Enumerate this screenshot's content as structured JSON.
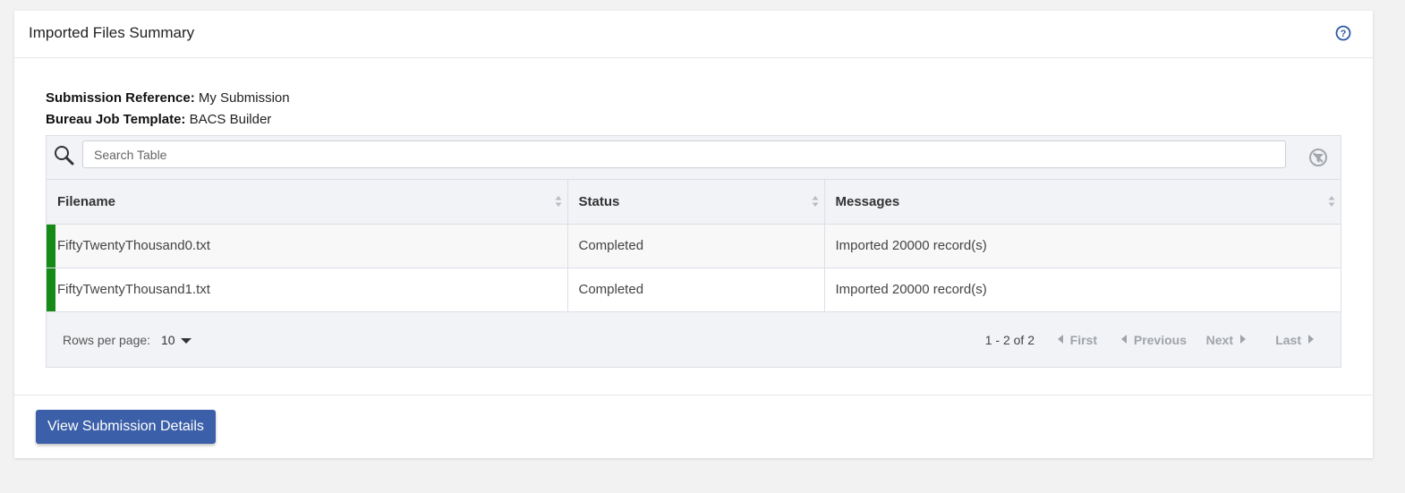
{
  "panel": {
    "title": "Imported Files Summary"
  },
  "meta": {
    "submission_reference_label": "Submission Reference:",
    "submission_reference_value": "My Submission",
    "bureau_job_template_label": "Bureau Job Template:",
    "bureau_job_template_value": "BACS Builder"
  },
  "search": {
    "placeholder": "Search Table"
  },
  "table": {
    "columns": [
      "Filename",
      "Status",
      "Messages"
    ],
    "rows": [
      {
        "filename": "FiftyTwentyThousand0.txt",
        "status": "Completed",
        "messages": "Imported 20000 record(s)"
      },
      {
        "filename": "FiftyTwentyThousand1.txt",
        "status": "Completed",
        "messages": "Imported 20000 record(s)"
      }
    ],
    "row_status_color": "#168a16"
  },
  "pagination": {
    "rows_per_page_label": "Rows per page:",
    "rows_per_page_value": "10",
    "page_info": "1 - 2 of 2",
    "first_label": "First",
    "previous_label": "Previous",
    "next_label": "Next",
    "last_label": "Last"
  },
  "actions": {
    "view_submission_details_label": "View Submission Details"
  },
  "colors": {
    "primary_button": "#3b5fa8",
    "help_icon": "#2f5aa8"
  },
  "icons": [
    "help-icon",
    "search-icon",
    "clear-filter-icon",
    "sort-icon",
    "chevron-down-icon",
    "chevron-left-icon",
    "chevron-right-icon"
  ]
}
